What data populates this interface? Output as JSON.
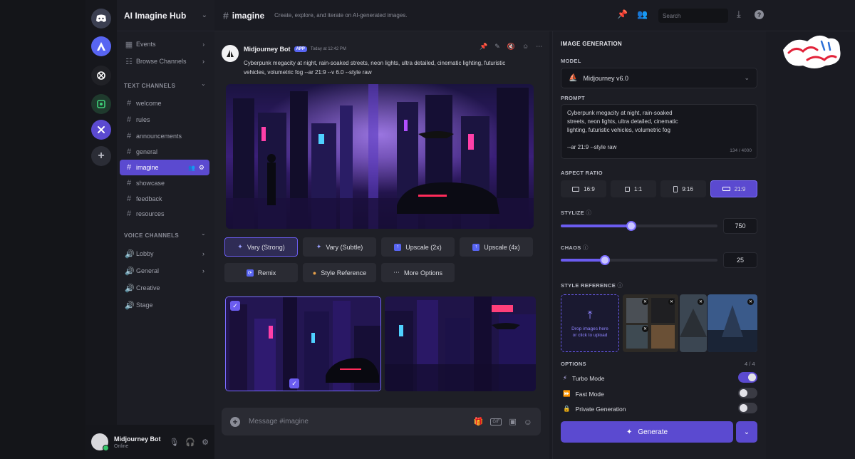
{
  "server": {
    "name": "AI Imagine Hub"
  },
  "servers": [
    "discord-icon",
    "ai-icon",
    "openai-icon",
    "green-icon",
    "active-server-icon",
    "add-server-icon"
  ],
  "sidebar": {
    "events": "Events",
    "browse": "Browse Channels",
    "text_title": "TEXT CHANNELS",
    "text_channels": [
      "welcome",
      "rules",
      "announcements",
      "general",
      "imagine",
      "showcase",
      "feedback",
      "resources"
    ],
    "voice_title": "VOICE CHANNELS",
    "voice_channels": [
      "Lobby",
      "General",
      "Creative",
      "Stage"
    ]
  },
  "user": {
    "name": "Midjourney Bot",
    "status": "Online"
  },
  "header": {
    "channel": "imagine",
    "description": "Create, explore, and iterate on AI-generated images.",
    "search_placeholder": "Search"
  },
  "message": {
    "author": "Midjourney Bot",
    "badge": "APP",
    "time": "Today at 12:42 PM",
    "text": "Cyberpunk megacity at night, rain-soaked streets, neon lights, ultra detailed, cinematic lighting, futuristic vehicles, volumetric fog --ar 21:9 --v 6.0 --style raw"
  },
  "actions": {
    "vary_strong": "Vary (Strong)",
    "vary_subtle": "Vary (Subtle)",
    "upscale2": "Upscale (2x)",
    "upscale4": "Upscale (4x)",
    "remix": "Remix",
    "style_ref": "Style Reference",
    "more": "More Options"
  },
  "composer": {
    "placeholder": "Message #imagine"
  },
  "panel": {
    "title": "IMAGE GENERATION",
    "model_label": "MODEL",
    "model": "Midjourney v6.0",
    "prompt_label": "PROMPT",
    "prompt_line1": "Cyberpunk megacity at night, rain-soaked",
    "prompt_line2": "streets, neon lights, ultra detailed, cinematic",
    "prompt_line3": "lighting, futuristic vehicles, volumetric fog",
    "prompt_line4": "--ar 21:9 --style raw",
    "prompt_count": "134 / 4000",
    "aspect_label": "ASPECT RATIO",
    "aspects": [
      "16:9",
      "1:1",
      "9:16",
      "21:9"
    ],
    "aspect_selected": "21:9",
    "stylize_label": "STYLIZE",
    "stylize": "750",
    "stylize_fraction": 0.45,
    "chaos_label": "CHAOS",
    "chaos": "25",
    "chaos_fraction": 0.28,
    "styleref_label": "STYLE REFERENCE",
    "drop_line1": "Drop images here",
    "drop_line2": "or click to upload",
    "options_label": "OPTIONS",
    "options_count": "4 / 4",
    "turbo": "Turbo Mode",
    "turbo_on": true,
    "fast": "Fast Mode",
    "fast_on": false,
    "private": "Private Generation",
    "private_on": false,
    "generate": "Generate"
  },
  "colors": {
    "accent": "#5b4ad0",
    "accent_light": "#7a6cff",
    "bg": "#1a1b22"
  }
}
